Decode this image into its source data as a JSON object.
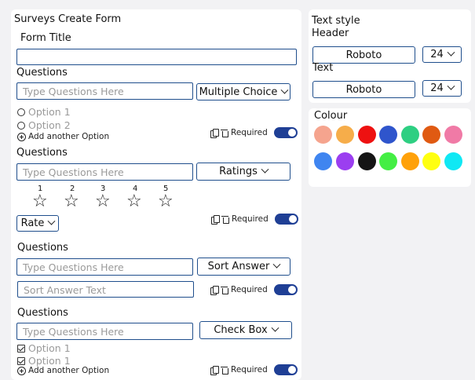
{
  "app": {
    "title": "Surveys",
    "subtitle": "Create Form"
  },
  "form": {
    "title_label": "Form Title",
    "title_value": ""
  },
  "q1": {
    "label": "Questions",
    "placeholder": "Type Questions Here",
    "type": "Multiple Choice",
    "options": [
      "Option 1",
      "Option 2"
    ],
    "add_option": "Add another Option",
    "required": "Required"
  },
  "q2": {
    "label": "Questions",
    "placeholder": "Type Questions Here",
    "type": "Ratings",
    "scale": [
      "1",
      "2",
      "3",
      "4",
      "5"
    ],
    "rate_label": "Rate",
    "required": "Required"
  },
  "q3": {
    "label": "Questions",
    "placeholder": "Type Questions Here",
    "type": "Sort Answer",
    "answer_placeholder": "Sort Answer Text",
    "required": "Required"
  },
  "q4": {
    "label": "Questions",
    "placeholder": "Type Questions Here",
    "type": "Check Box",
    "options": [
      "Option 1",
      "Option 1"
    ],
    "add_option": "Add another Option",
    "required": "Required"
  },
  "text_style": {
    "heading": "Text style",
    "header_label": "Header",
    "header_font": "Roboto",
    "header_size": "24",
    "text_label": "Text",
    "text_font": "Roboto",
    "text_size": "24"
  },
  "colour": {
    "heading": "Colour",
    "swatches": [
      "#f5a48e",
      "#f6ad4a",
      "#ee1111",
      "#2f55cc",
      "#2ecf82",
      "#e05a12",
      "#f07aa6",
      "#3f85f0",
      "#9b3ef0",
      "#151515",
      "#44ee44",
      "#ffa10a",
      "#ffff10",
      "#10e8f4"
    ]
  }
}
